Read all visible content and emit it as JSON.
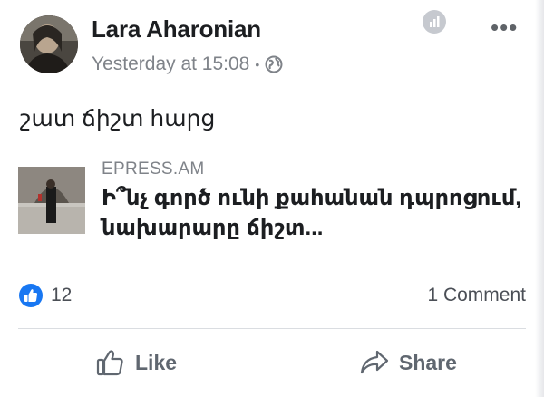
{
  "post": {
    "author": "Lara Aharonian",
    "timestamp": "Yesterday at 15:08",
    "separator": "•",
    "privacy_icon": "globe-icon",
    "text": "շատ ճիշտ հարց"
  },
  "link_preview": {
    "domain": "EPRESS.AM",
    "headline": "Ի՞նչ գործ ունի քահանան դպրոցում, նախարարը ճիշտ..."
  },
  "engagement": {
    "reaction_icon": "like-reaction-icon",
    "reaction_count": "12",
    "comments": "1 Comment"
  },
  "actions": {
    "like_label": "Like",
    "share_label": "Share"
  },
  "colors": {
    "accent": "#1877f2",
    "meta_text": "#7f8389",
    "action_text": "#606770"
  }
}
